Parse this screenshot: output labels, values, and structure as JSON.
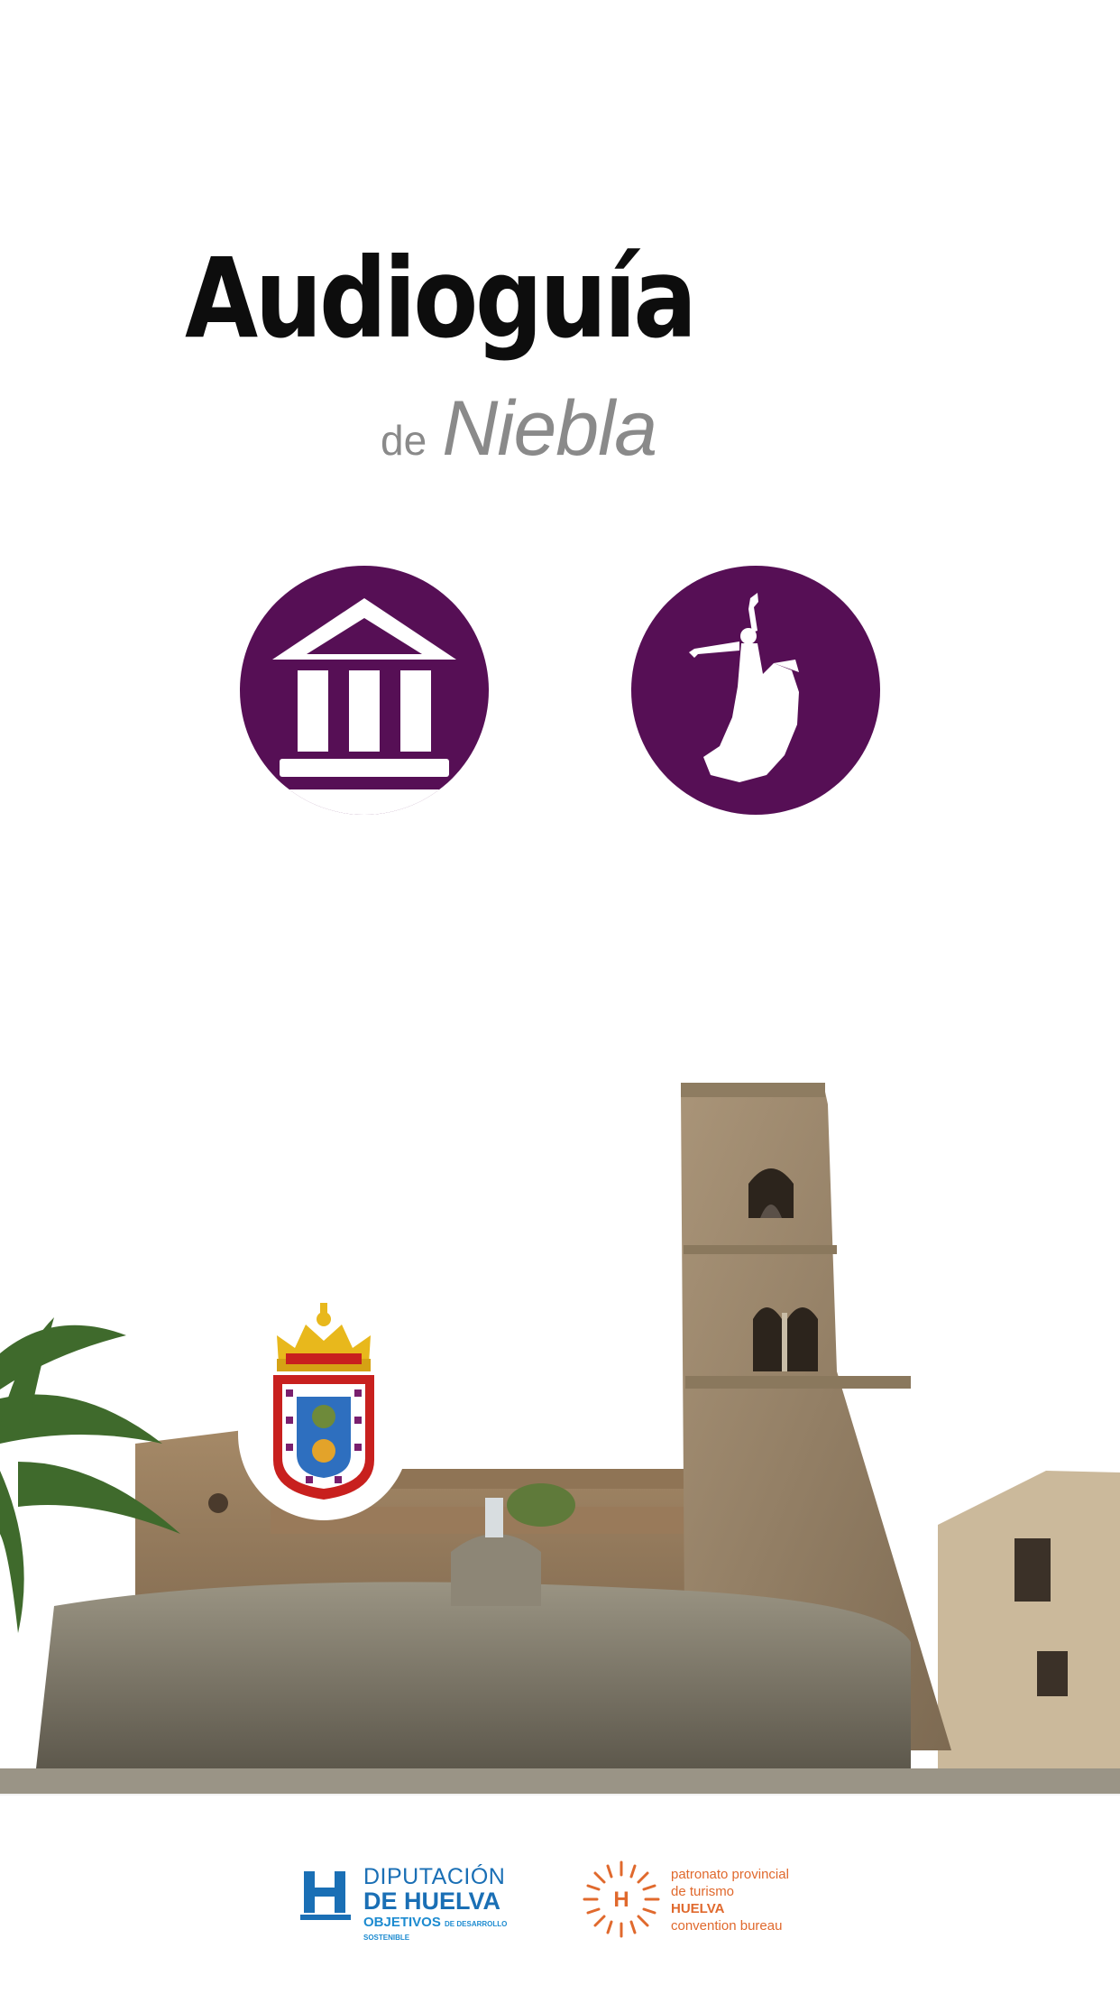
{
  "app": {
    "title": "Audioguía",
    "subtitle_prefix": "de",
    "subtitle_place": "Niebla"
  },
  "menu": {
    "monuments_icon": "classical-building-icon",
    "culture_icon": "flamenco-dancer-icon",
    "accent_color": "#560f55"
  },
  "crest": {
    "icon": "coat-of-arms-icon"
  },
  "footer": {
    "diputacion": {
      "line1": "DIPUTACIÓN",
      "line2_prefix": "DE",
      "line2_name": "HUELVA",
      "line3": "OBJETIVOS",
      "line3_small": "DE DESARROLLO SOSTENIBLE"
    },
    "patronato": {
      "letter": "H",
      "line1": "patronato provincial",
      "line2": "de turismo",
      "line3": "HUELVA",
      "line4": "convention bureau"
    }
  }
}
